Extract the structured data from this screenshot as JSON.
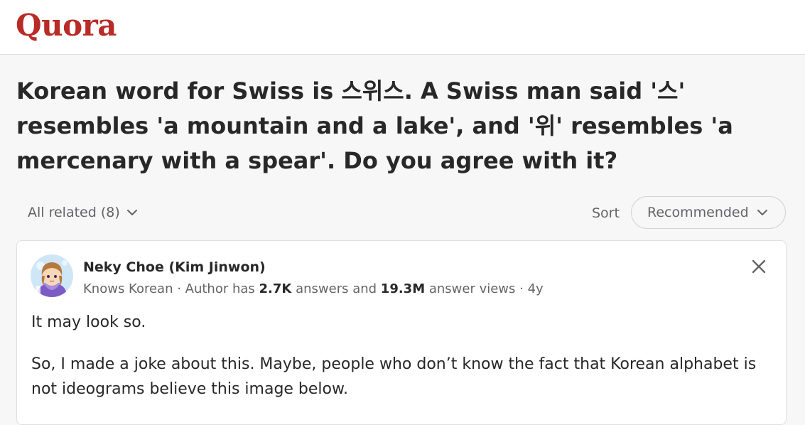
{
  "header": {
    "logo": "Quora"
  },
  "question": {
    "title": "Korean word for Swiss is 스위스. A Swiss man said '스' resembles 'a mountain and a lake', and '위' resembles 'a mercenary with a spear'. Do you agree with it?"
  },
  "filters": {
    "all_related": "All related (8)",
    "sort_label": "Sort",
    "sort_value": "Recommended"
  },
  "answer": {
    "author_name": "Neky Choe (Kim Jinwon)",
    "credential": "Knows Korean",
    "sep1": " · ",
    "author_has": "Author has ",
    "answer_count": "2.7K",
    "answers_and": " answers and ",
    "view_count": "19.3M",
    "answer_views": " answer views",
    "sep2": " · ",
    "age": "4y",
    "paragraphs": [
      "It may look so.",
      "So, I made a joke about this. Maybe, people who don’t know the fact that Korean alphabet is not ideograms believe this image below."
    ]
  },
  "colors": {
    "brand": "#b92b27",
    "text": "#282829",
    "muted": "#636466",
    "background": "#f7f7f8"
  },
  "icons": {
    "all_related_chevron": "chevron-down-icon",
    "sort_chevron": "chevron-down-icon",
    "close": "close-icon"
  }
}
